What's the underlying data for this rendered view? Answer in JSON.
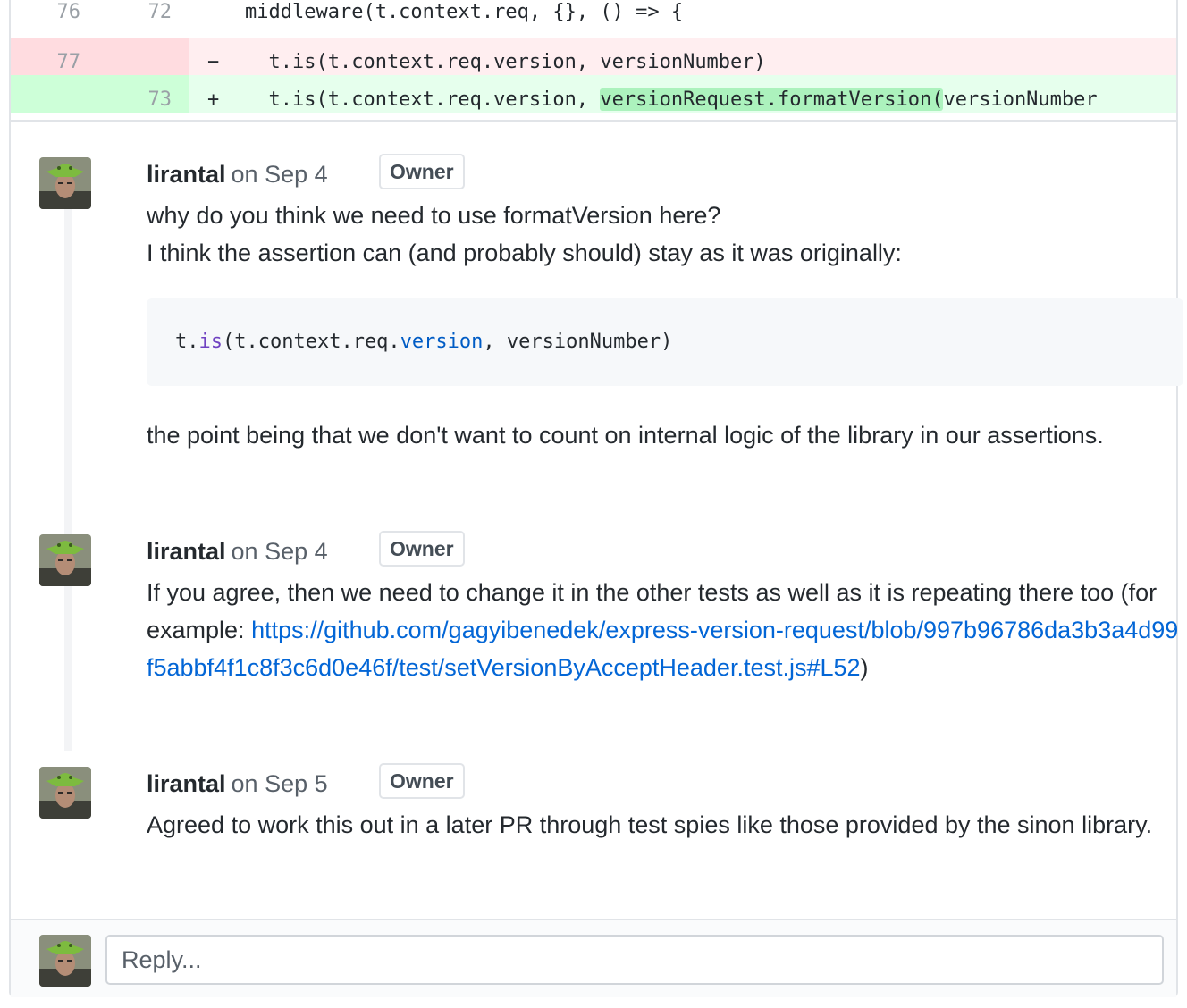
{
  "diff": {
    "rows": [
      {
        "old": "76",
        "new": "72",
        "sign": "",
        "code": "middleware(t.context.req, {}, () => {"
      },
      {
        "old": "77",
        "new": "",
        "sign": "−",
        "code": "  t.is(t.context.req.version, versionNumber)"
      },
      {
        "old": "",
        "new": "73",
        "sign": "+",
        "code_pre": "  t.is(t.context.req.version, ",
        "code_hl": "versionRequest.formatVersion(",
        "code_post": "versionNumber"
      }
    ]
  },
  "comments": [
    {
      "author": "lirantal",
      "when": "on Sep 4",
      "badge": "Owner",
      "line1": "why do you think we need to use formatVersion here?",
      "line2": "I think the assertion can (and probably should) stay as it was originally:",
      "code": {
        "p1": "t.",
        "kw": "is",
        "p2": "(t.context.req.",
        "prop": "version",
        "p3": ", versionNumber)"
      },
      "line3": "the point being that we don't want to count on internal logic of the library in our assertions."
    },
    {
      "author": "lirantal",
      "when": "on Sep 4",
      "badge": "Owner",
      "text_pre": "If you agree, then we need to change it in the other tests as well as it is repeating there too (for example: ",
      "link": "https://github.com/gagyibenedek/express-version-request/blob/997b96786da3b3a4d99f5abbf4f1c8f3c6d0e46f/test/setVersionByAcceptHeader.test.js#L52",
      "text_post": ")"
    },
    {
      "author": "lirantal",
      "when": "on Sep 5",
      "badge": "Owner",
      "text": "Agreed to work this out in a later PR through test spies like those provided by the sinon library."
    }
  ],
  "reply": {
    "placeholder": "Reply..."
  }
}
